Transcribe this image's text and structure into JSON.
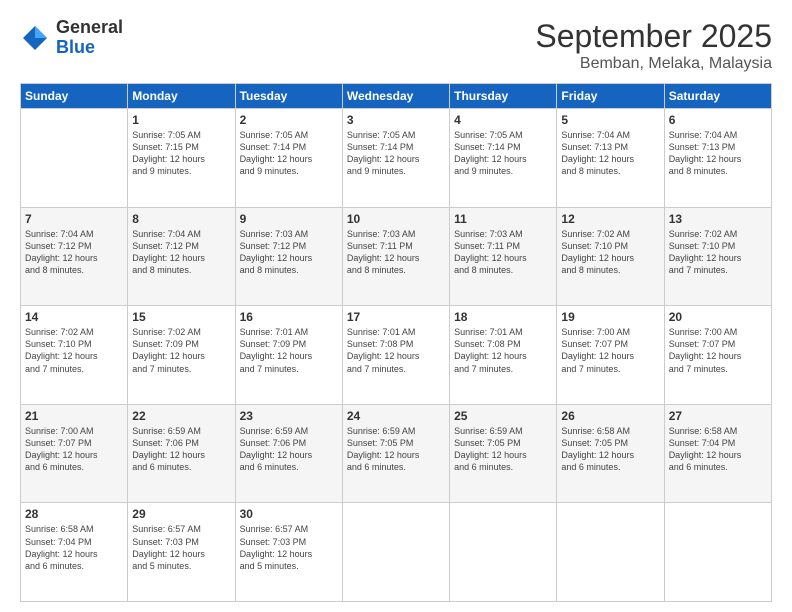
{
  "logo": {
    "general": "General",
    "blue": "Blue"
  },
  "header": {
    "month": "September 2025",
    "location": "Bemban, Melaka, Malaysia"
  },
  "weekdays": [
    "Sunday",
    "Monday",
    "Tuesday",
    "Wednesday",
    "Thursday",
    "Friday",
    "Saturday"
  ],
  "weeks": [
    [
      {
        "day": "",
        "info": ""
      },
      {
        "day": "1",
        "info": "Sunrise: 7:05 AM\nSunset: 7:15 PM\nDaylight: 12 hours\nand 9 minutes."
      },
      {
        "day": "2",
        "info": "Sunrise: 7:05 AM\nSunset: 7:14 PM\nDaylight: 12 hours\nand 9 minutes."
      },
      {
        "day": "3",
        "info": "Sunrise: 7:05 AM\nSunset: 7:14 PM\nDaylight: 12 hours\nand 9 minutes."
      },
      {
        "day": "4",
        "info": "Sunrise: 7:05 AM\nSunset: 7:14 PM\nDaylight: 12 hours\nand 9 minutes."
      },
      {
        "day": "5",
        "info": "Sunrise: 7:04 AM\nSunset: 7:13 PM\nDaylight: 12 hours\nand 8 minutes."
      },
      {
        "day": "6",
        "info": "Sunrise: 7:04 AM\nSunset: 7:13 PM\nDaylight: 12 hours\nand 8 minutes."
      }
    ],
    [
      {
        "day": "7",
        "info": "Sunrise: 7:04 AM\nSunset: 7:12 PM\nDaylight: 12 hours\nand 8 minutes."
      },
      {
        "day": "8",
        "info": "Sunrise: 7:04 AM\nSunset: 7:12 PM\nDaylight: 12 hours\nand 8 minutes."
      },
      {
        "day": "9",
        "info": "Sunrise: 7:03 AM\nSunset: 7:12 PM\nDaylight: 12 hours\nand 8 minutes."
      },
      {
        "day": "10",
        "info": "Sunrise: 7:03 AM\nSunset: 7:11 PM\nDaylight: 12 hours\nand 8 minutes."
      },
      {
        "day": "11",
        "info": "Sunrise: 7:03 AM\nSunset: 7:11 PM\nDaylight: 12 hours\nand 8 minutes."
      },
      {
        "day": "12",
        "info": "Sunrise: 7:02 AM\nSunset: 7:10 PM\nDaylight: 12 hours\nand 8 minutes."
      },
      {
        "day": "13",
        "info": "Sunrise: 7:02 AM\nSunset: 7:10 PM\nDaylight: 12 hours\nand 7 minutes."
      }
    ],
    [
      {
        "day": "14",
        "info": "Sunrise: 7:02 AM\nSunset: 7:10 PM\nDaylight: 12 hours\nand 7 minutes."
      },
      {
        "day": "15",
        "info": "Sunrise: 7:02 AM\nSunset: 7:09 PM\nDaylight: 12 hours\nand 7 minutes."
      },
      {
        "day": "16",
        "info": "Sunrise: 7:01 AM\nSunset: 7:09 PM\nDaylight: 12 hours\nand 7 minutes."
      },
      {
        "day": "17",
        "info": "Sunrise: 7:01 AM\nSunset: 7:08 PM\nDaylight: 12 hours\nand 7 minutes."
      },
      {
        "day": "18",
        "info": "Sunrise: 7:01 AM\nSunset: 7:08 PM\nDaylight: 12 hours\nand 7 minutes."
      },
      {
        "day": "19",
        "info": "Sunrise: 7:00 AM\nSunset: 7:07 PM\nDaylight: 12 hours\nand 7 minutes."
      },
      {
        "day": "20",
        "info": "Sunrise: 7:00 AM\nSunset: 7:07 PM\nDaylight: 12 hours\nand 7 minutes."
      }
    ],
    [
      {
        "day": "21",
        "info": "Sunrise: 7:00 AM\nSunset: 7:07 PM\nDaylight: 12 hours\nand 6 minutes."
      },
      {
        "day": "22",
        "info": "Sunrise: 6:59 AM\nSunset: 7:06 PM\nDaylight: 12 hours\nand 6 minutes."
      },
      {
        "day": "23",
        "info": "Sunrise: 6:59 AM\nSunset: 7:06 PM\nDaylight: 12 hours\nand 6 minutes."
      },
      {
        "day": "24",
        "info": "Sunrise: 6:59 AM\nSunset: 7:05 PM\nDaylight: 12 hours\nand 6 minutes."
      },
      {
        "day": "25",
        "info": "Sunrise: 6:59 AM\nSunset: 7:05 PM\nDaylight: 12 hours\nand 6 minutes."
      },
      {
        "day": "26",
        "info": "Sunrise: 6:58 AM\nSunset: 7:05 PM\nDaylight: 12 hours\nand 6 minutes."
      },
      {
        "day": "27",
        "info": "Sunrise: 6:58 AM\nSunset: 7:04 PM\nDaylight: 12 hours\nand 6 minutes."
      }
    ],
    [
      {
        "day": "28",
        "info": "Sunrise: 6:58 AM\nSunset: 7:04 PM\nDaylight: 12 hours\nand 6 minutes."
      },
      {
        "day": "29",
        "info": "Sunrise: 6:57 AM\nSunset: 7:03 PM\nDaylight: 12 hours\nand 5 minutes."
      },
      {
        "day": "30",
        "info": "Sunrise: 6:57 AM\nSunset: 7:03 PM\nDaylight: 12 hours\nand 5 minutes."
      },
      {
        "day": "",
        "info": ""
      },
      {
        "day": "",
        "info": ""
      },
      {
        "day": "",
        "info": ""
      },
      {
        "day": "",
        "info": ""
      }
    ]
  ]
}
